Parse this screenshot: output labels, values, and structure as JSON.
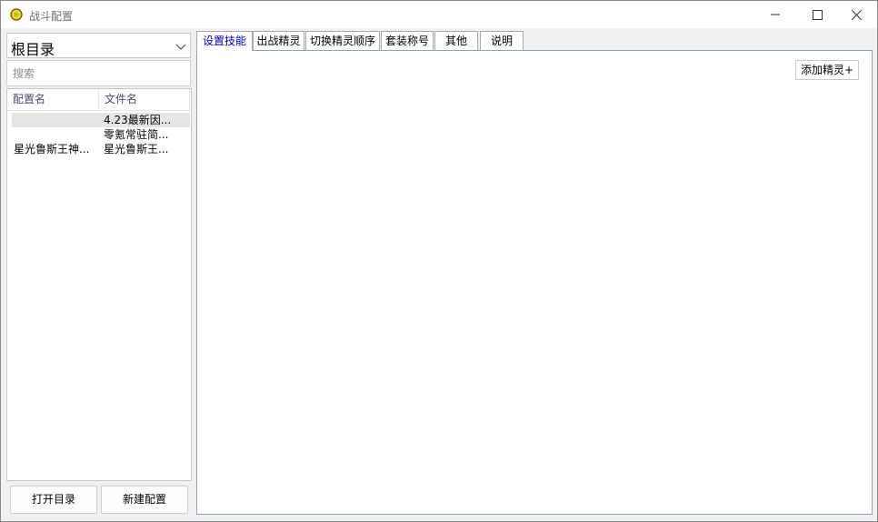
{
  "window": {
    "title": "战斗配置",
    "controls": [
      "minimize-icon",
      "maximize-icon",
      "close-icon"
    ]
  },
  "left": {
    "directory": {
      "value": "根目录"
    },
    "search": {
      "placeholder": "搜索",
      "value": ""
    },
    "list": {
      "columns": [
        "配置名",
        "文件名"
      ],
      "rows": [
        {
          "name": "",
          "file": "4.23最新因...",
          "selected": true
        },
        {
          "name": "",
          "file": "零氪常驻简...",
          "selected": false
        },
        {
          "name": "星光鲁斯王神...",
          "file": "星光鲁斯王...",
          "selected": false
        }
      ]
    },
    "buttons": {
      "open_dir": "打开目录",
      "new_config": "新建配置"
    }
  },
  "tabs": [
    {
      "label": "设置技能",
      "active": true
    },
    {
      "label": "出战精灵",
      "active": false
    },
    {
      "label": "切换精灵顺序",
      "active": false
    },
    {
      "label": "套装称号",
      "active": false
    },
    {
      "label": "其他",
      "active": false
    },
    {
      "label": "说明",
      "active": false
    }
  ],
  "panel": {
    "add_label": "添加精灵+"
  },
  "colors": {
    "active_tab": "#0000cc",
    "panel_border": "#8aa4c2",
    "header_text": "#4a4a72"
  }
}
